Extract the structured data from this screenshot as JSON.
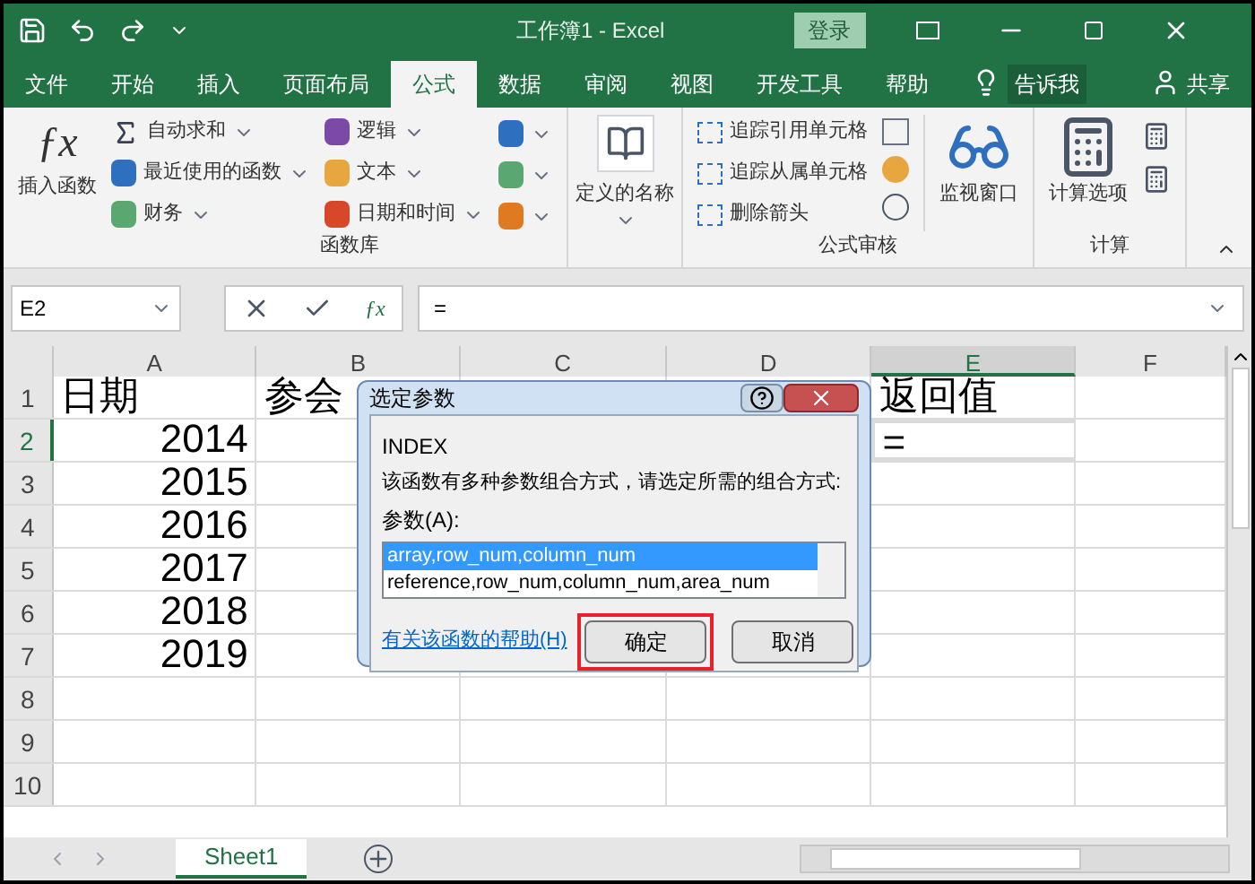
{
  "title_bar": {
    "title": "工作簿1 - Excel",
    "login": "登录"
  },
  "tabs": [
    {
      "label": "文件",
      "selected": false
    },
    {
      "label": "开始",
      "selected": false
    },
    {
      "label": "插入",
      "selected": false
    },
    {
      "label": "页面布局",
      "selected": false
    },
    {
      "label": "公式",
      "selected": true
    },
    {
      "label": "数据",
      "selected": false
    },
    {
      "label": "审阅",
      "selected": false
    },
    {
      "label": "视图",
      "selected": false
    },
    {
      "label": "开发工具",
      "selected": false
    },
    {
      "label": "帮助",
      "selected": false
    }
  ],
  "tell_me": "告诉我",
  "share": "共享",
  "ribbon": {
    "fx_symbol": "ƒx",
    "insert_function": "插入函数",
    "library_items": [
      {
        "label": "自动求和",
        "kind": "sum"
      },
      {
        "label": "最近使用的函数",
        "kind": "recent"
      },
      {
        "label": "财务",
        "kind": "finance"
      },
      {
        "label": "逻辑",
        "kind": "logic"
      },
      {
        "label": "文本",
        "kind": "text"
      },
      {
        "label": "日期和时间",
        "kind": "date"
      }
    ],
    "library_label": "函数库",
    "defined_names": "定义的名称",
    "audit_items": [
      "追踪引用单元格",
      "追踪从属单元格",
      "删除箭头"
    ],
    "watch_window": "监视窗口",
    "audit_label": "公式审核",
    "calc_options": "计算选项",
    "calc_label": "计算"
  },
  "formula_bar": {
    "name_box": "E2",
    "fx_symbol": "ƒx",
    "value": "="
  },
  "columns": [
    {
      "label": "A",
      "selected": false
    },
    {
      "label": "B",
      "selected": false
    },
    {
      "label": "C",
      "selected": false
    },
    {
      "label": "D",
      "selected": false
    },
    {
      "label": "E",
      "selected": true
    },
    {
      "label": "F",
      "selected": false
    }
  ],
  "rows": [
    {
      "number": "1",
      "selected": false,
      "cells": [
        "日期",
        "参会",
        "",
        "",
        "返回值",
        ""
      ]
    },
    {
      "number": "2",
      "selected": true,
      "cells": [
        "2014",
        "",
        "",
        "",
        "=",
        ""
      ]
    },
    {
      "number": "3",
      "selected": false,
      "cells": [
        "2015",
        "",
        "",
        "",
        "",
        ""
      ]
    },
    {
      "number": "4",
      "selected": false,
      "cells": [
        "2016",
        "",
        "",
        "",
        "",
        ""
      ]
    },
    {
      "number": "5",
      "selected": false,
      "cells": [
        "2017",
        "",
        "",
        "",
        "",
        ""
      ]
    },
    {
      "number": "6",
      "selected": false,
      "cells": [
        "2018",
        "",
        "",
        "",
        "",
        ""
      ]
    },
    {
      "number": "7",
      "selected": false,
      "cells": [
        "2019",
        "",
        "",
        "",
        "",
        ""
      ]
    },
    {
      "number": "8",
      "selected": false,
      "cells": [
        "",
        "",
        "",
        "",
        "",
        ""
      ]
    },
    {
      "number": "9",
      "selected": false,
      "cells": [
        "",
        "",
        "",
        "",
        "",
        ""
      ]
    },
    {
      "number": "10",
      "selected": false,
      "cells": [
        "",
        "",
        "",
        "",
        "",
        ""
      ]
    }
  ],
  "dialog": {
    "title": "选定参数",
    "function": "INDEX",
    "description": "该函数有多种参数组合方式，请选定所需的组合方式:",
    "list_label": "参数(A):",
    "options": [
      {
        "text": "array,row_num,column_num",
        "selected": true
      },
      {
        "text": "reference,row_num,column_num,area_num",
        "selected": false
      }
    ],
    "help_link": "有关该函数的帮助(H)",
    "buttons": [
      {
        "label": "确定",
        "highlighted": true
      },
      {
        "label": "取消",
        "highlighted": false
      }
    ]
  },
  "sheets": [
    {
      "label": "Sheet1",
      "selected": true
    }
  ]
}
